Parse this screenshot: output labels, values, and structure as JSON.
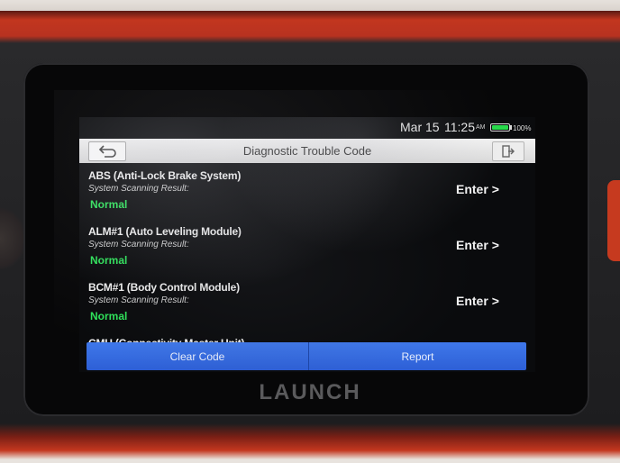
{
  "status_bar": {
    "date": "Mar 15",
    "time": "11:25",
    "ampm": "AM",
    "battery_percent": "100%",
    "battery_level": 1.0,
    "battery_color": "#27d94a"
  },
  "header": {
    "title": "Diagnostic Trouble Code",
    "back_icon": "back-arrow-icon",
    "exit_icon": "exit-door-icon"
  },
  "modules": [
    {
      "name": "ABS (Anti-Lock Brake System)",
      "label": "System Scanning Result:",
      "status": "Normal",
      "action": "Enter"
    },
    {
      "name": "ALM#1 (Auto Leveling Module)",
      "label": "System Scanning Result:",
      "status": "Normal",
      "action": "Enter"
    },
    {
      "name": "BCM#1 (Body Control Module)",
      "label": "System Scanning Result:",
      "status": "Normal",
      "action": "Enter"
    },
    {
      "name": "CMU (Connectivity Master Unit)"
    }
  ],
  "footer": {
    "clear_code": "Clear Code",
    "report": "Report",
    "accent_color": "#2d5fd6"
  },
  "device": {
    "brand": "LAUNCH"
  },
  "colors": {
    "status_normal": "#2ee35a",
    "device_body": "#c3371f"
  }
}
